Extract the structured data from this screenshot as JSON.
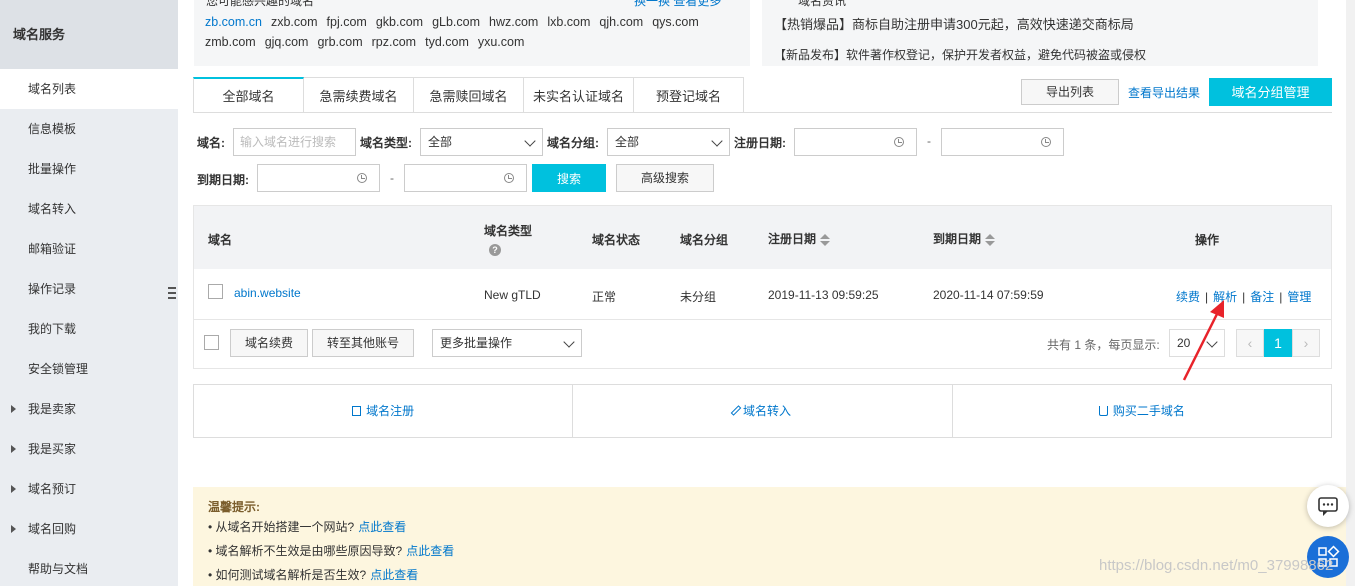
{
  "sidebar": {
    "header": "域名服务",
    "items": [
      {
        "label": "域名列表",
        "active": true,
        "expandable": false
      },
      {
        "label": "信息模板",
        "active": false,
        "expandable": false
      },
      {
        "label": "批量操作",
        "active": false,
        "expandable": false
      },
      {
        "label": "域名转入",
        "active": false,
        "expandable": false
      },
      {
        "label": "邮箱验证",
        "active": false,
        "expandable": false
      },
      {
        "label": "操作记录",
        "active": false,
        "expandable": false
      },
      {
        "label": "我的下载",
        "active": false,
        "expandable": false
      },
      {
        "label": "安全锁管理",
        "active": false,
        "expandable": false
      },
      {
        "label": "我是卖家",
        "active": false,
        "expandable": true
      },
      {
        "label": "我是买家",
        "active": false,
        "expandable": true
      },
      {
        "label": "域名预订",
        "active": false,
        "expandable": true
      },
      {
        "label": "域名回购",
        "active": false,
        "expandable": true
      },
      {
        "label": "帮助与文档",
        "active": false,
        "expandable": false
      }
    ]
  },
  "promo": {
    "left_partial_title": "您可能感兴趣的域名",
    "left_partial_link": "换一换  查看更多",
    "suffix_row1": [
      "zb.com.cn",
      "zxb.com",
      "fpj.com",
      "gkb.com",
      "gLb.com",
      "hwz.com",
      "lxb.com",
      "qjh.com",
      "qys.com"
    ],
    "suffix_row2": [
      "zmb.com",
      "gjq.com",
      "grb.com",
      "rpz.com",
      "tyd.com",
      "yxu.com"
    ],
    "right_partial_title": "域名资讯",
    "news1": "【热销爆品】商标自助注册申请300元起，高效快速递交商标局",
    "news2": "【新品发布】软件著作权登记，保护开发者权益，避免代码被盗或侵权"
  },
  "tabs": [
    "全部域名",
    "急需续费域名",
    "急需赎回域名",
    "未实名认证域名",
    "预登记域名"
  ],
  "toolbar": {
    "export_label": "导出列表",
    "view_export_label": "查看导出结果",
    "group_manage_label": "域名分组管理"
  },
  "filters": {
    "domain_label": "域名:",
    "domain_placeholder": "输入域名进行搜索",
    "type_label": "域名类型:",
    "type_value": "全部",
    "group_label": "域名分组:",
    "group_value": "全部",
    "reg_date_label": "注册日期:",
    "exp_date_label": "到期日期:",
    "dash": "-",
    "search_label": "搜索",
    "advanced_label": "高级搜索"
  },
  "table": {
    "headers": {
      "domain": "域名",
      "type": "域名类型",
      "status": "域名状态",
      "group": "域名分组",
      "reg_date": "注册日期",
      "exp_date": "到期日期",
      "ops": "操作"
    },
    "rows": [
      {
        "domain": "abin.website",
        "type": "New gTLD",
        "status": "正常",
        "group": "未分组",
        "reg_date": "2019-11-13 09:59:25",
        "exp_date": "2020-11-14 07:59:59",
        "ops": [
          "续费",
          "解析",
          "备注",
          "管理"
        ]
      }
    ],
    "footer": {
      "renew_label": "域名续费",
      "transfer_label": "转至其他账号",
      "more_batch_label": "更多批量操作",
      "total_text": "共有 1 条，每页显示:",
      "page_size": "20",
      "prev": "‹",
      "current_page": "1",
      "next": "›"
    }
  },
  "actions": [
    {
      "label": "域名注册",
      "icon": "register-icon"
    },
    {
      "label": "域名转入",
      "icon": "edit-icon"
    },
    {
      "label": "购买二手域名",
      "icon": "cart-icon"
    }
  ],
  "tips": {
    "title": "温馨提示:",
    "items": [
      {
        "text": "• 从域名开始搭建一个网站?",
        "link": "点此查看"
      },
      {
        "text": "• 域名解析不生效是由哪些原因导致?",
        "link": "点此查看"
      },
      {
        "text": "• 如何测试域名解析是否生效?",
        "link": "点此查看"
      }
    ]
  },
  "watermark": "https://blog.csdn.net/m0_37998862",
  "colors": {
    "accent": "#00c1de",
    "link": "#0077cc",
    "annotation_arrow": "#e8232a",
    "tips_bg": "#fdf6df"
  }
}
